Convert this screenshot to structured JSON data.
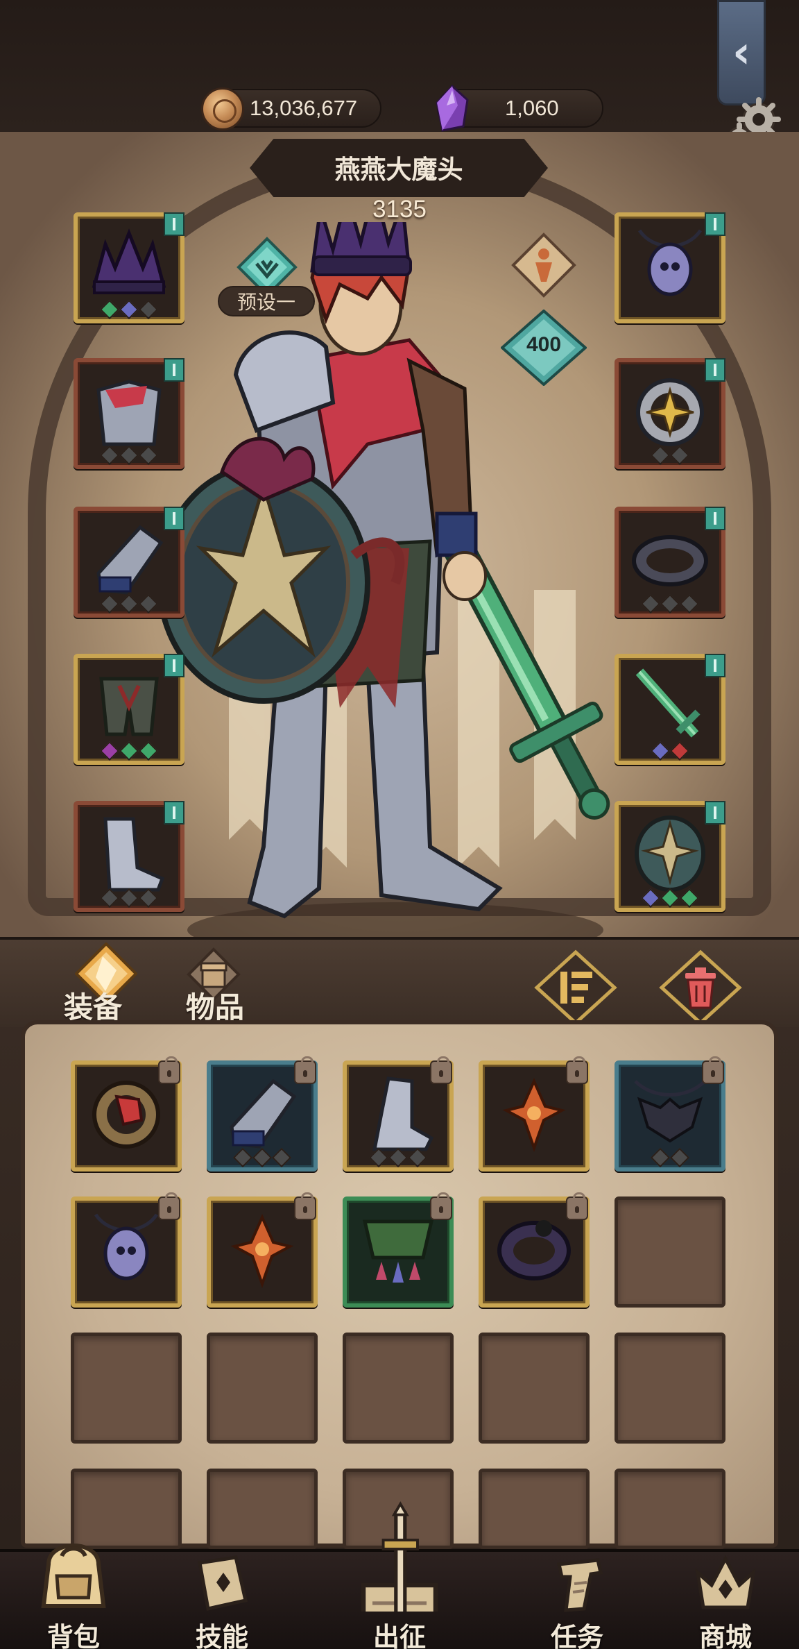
{
  "resources": {
    "gold": "13,036,677",
    "crystal": "1,060"
  },
  "character": {
    "name": "燕燕大魔头",
    "power": "3135",
    "preset_label": "预设一",
    "level": "400"
  },
  "equipped": {
    "left": [
      {
        "name": "helmet",
        "rarity": "gold",
        "gems": [
          "#3fa86a",
          "#6a6cc0",
          "#4a4a4a"
        ]
      },
      {
        "name": "chest-armor",
        "rarity": "red",
        "gems": [
          "#4a4a4a",
          "#4a4a4a",
          "#4a4a4a"
        ]
      },
      {
        "name": "gauntlet",
        "rarity": "red",
        "gems": [
          "#4a4a4a",
          "#4a4a4a",
          "#4a4a4a"
        ]
      },
      {
        "name": "leg-armor",
        "rarity": "gold",
        "gems": [
          "#9b3fa6",
          "#3fa86a",
          "#3fa86a"
        ]
      },
      {
        "name": "boots",
        "rarity": "red",
        "gems": [
          "#4a4a4a",
          "#4a4a4a",
          "#4a4a4a"
        ]
      }
    ],
    "right": [
      {
        "name": "amulet",
        "rarity": "gold",
        "gems": []
      },
      {
        "name": "star-ring",
        "rarity": "red",
        "gems": [
          "#4a4a4a",
          "#4a4a4a"
        ]
      },
      {
        "name": "dark-ring",
        "rarity": "red",
        "gems": [
          "#4a4a4a",
          "#4a4a4a",
          "#4a4a4a"
        ]
      },
      {
        "name": "green-sword",
        "rarity": "gold",
        "gems": [
          "#6a6cc0",
          "#c03a3a"
        ]
      },
      {
        "name": "round-shield",
        "rarity": "gold",
        "gems": [
          "#6a6cc0",
          "#3fa86a",
          "#3fa86a"
        ]
      }
    ]
  },
  "tabs": {
    "equipment": "装备",
    "items": "物品"
  },
  "inventory": [
    {
      "name": "serpent-ring",
      "rarity": "gold",
      "gems": [],
      "locked": true
    },
    {
      "name": "gauntlet",
      "rarity": "blue",
      "gems": [
        "#4a4a4a",
        "#4a4a4a",
        "#4a4a4a"
      ],
      "locked": true
    },
    {
      "name": "steel-boot",
      "rarity": "gold",
      "gems": [
        "#4a4a4a",
        "#4a4a4a",
        "#4a4a4a"
      ],
      "locked": true
    },
    {
      "name": "flame-amulet",
      "rarity": "gold",
      "gems": [],
      "locked": true
    },
    {
      "name": "bat-necklace",
      "rarity": "blue",
      "gems": [
        "#4a4a4a",
        "#4a4a4a"
      ],
      "locked": true
    },
    {
      "name": "skull-pendant",
      "rarity": "gold",
      "gems": [],
      "locked": true
    },
    {
      "name": "flame-amulet",
      "rarity": "gold",
      "gems": [],
      "locked": true
    },
    {
      "name": "spiked-collar",
      "rarity": "green",
      "gems": [],
      "locked": true
    },
    {
      "name": "chain-ring",
      "rarity": "gold",
      "gems": [],
      "locked": true
    },
    {
      "name": "",
      "rarity": "empty",
      "gems": [],
      "locked": false
    }
  ],
  "nav": [
    {
      "label": "背包",
      "icon": "backpack-icon"
    },
    {
      "label": "技能",
      "icon": "skill-book-icon"
    },
    {
      "label": "出征",
      "icon": "sword-map-icon"
    },
    {
      "label": "任务",
      "icon": "scroll-quest-icon"
    },
    {
      "label": "商城",
      "icon": "crown-shop-icon"
    }
  ],
  "colors": {
    "rarity_gold": "#c9a552",
    "rarity_red": "#8a4a36",
    "rarity_blue": "#4a7d8c",
    "rarity_green": "#3c8c55",
    "accent_teal": "#3c9d8b"
  }
}
